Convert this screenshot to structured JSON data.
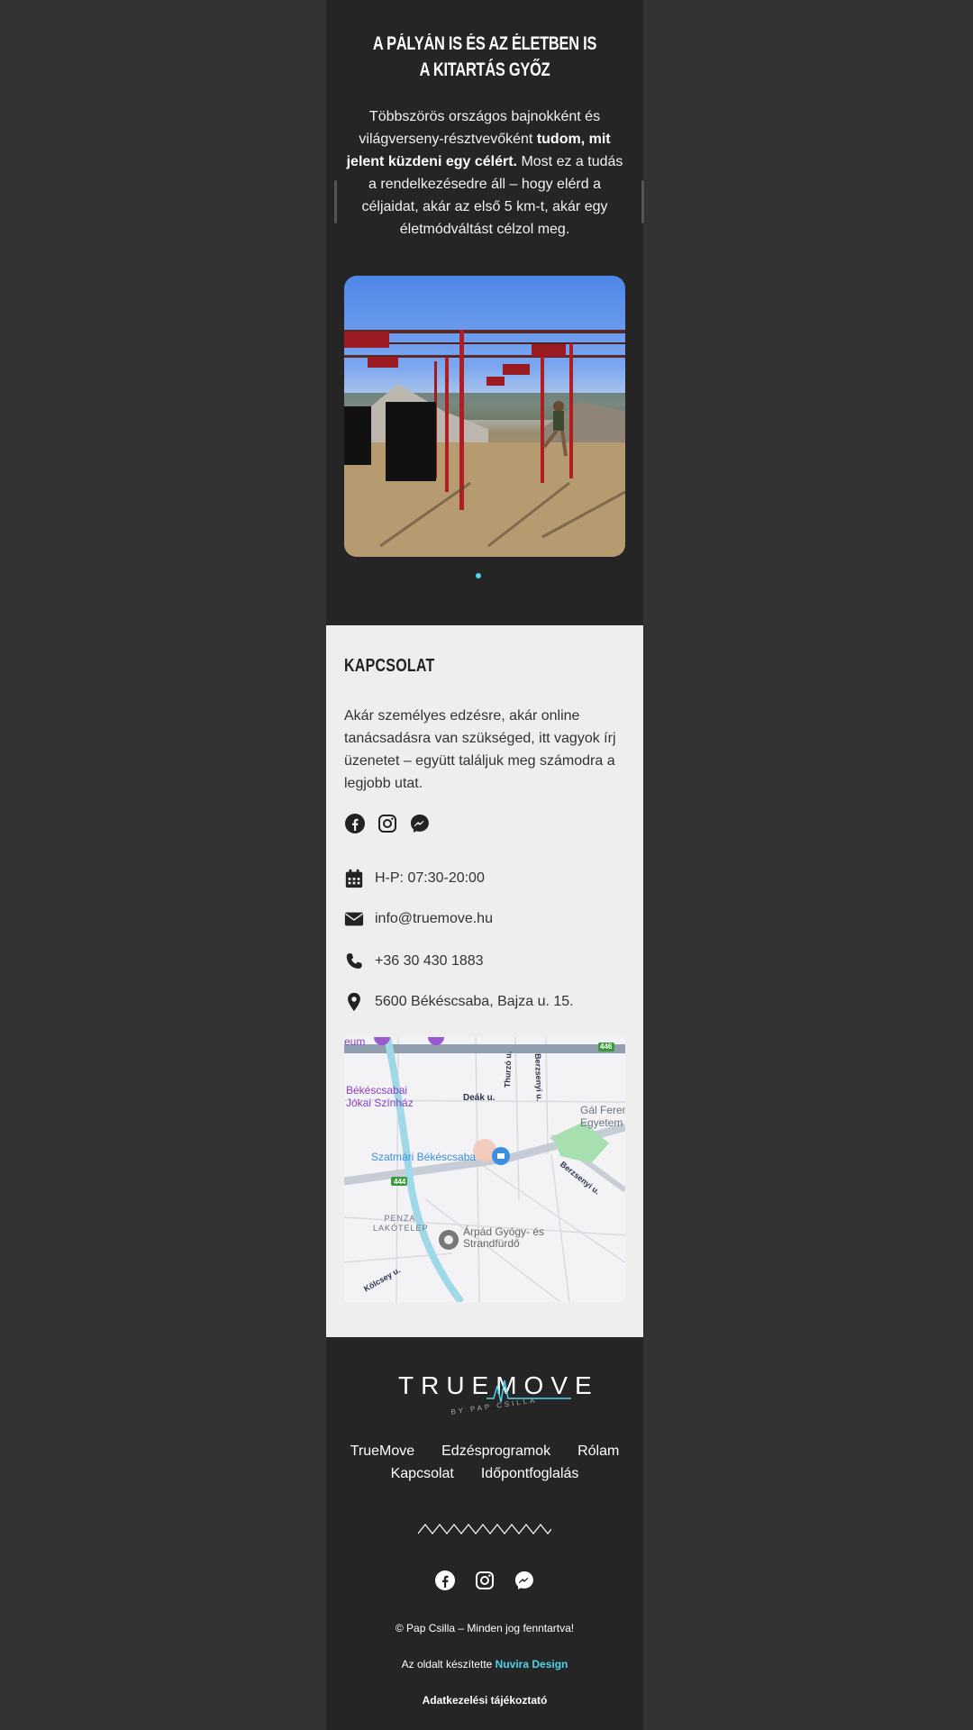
{
  "hero": {
    "title": "A PÁLYÁN IS ÉS AZ ÉLETBEN IS A KITARTÁS GYŐZ",
    "text_pre": "Többszörös országos bajnokként és világverseny-résztvevőként ",
    "text_bold": "tudom, mit jelent küzdeni egy célért.",
    "text_post": " Most ez a tudás a rendelkezésedre áll – hogy elérd a céljaidat, akár az első 5 km-t, akár egy életmódváltást célzol meg."
  },
  "contact": {
    "title": "KAPCSOLAT",
    "text": "Akár személyes edzésre, akár online tanácsadásra van szükséged, itt vagyok írj üzenetet – együtt találjuk meg számodra a legjobb utat.",
    "hours": "H-P: 07:30-20:00",
    "email": "info@truemove.hu",
    "phone": "+36 30 430 1883",
    "address": "5600 Békéscsaba, Bajza u. 15."
  },
  "map": {
    "labels": {
      "theatre": "Békéscsabai Jókai Színház",
      "deak": "Deák u.",
      "thurzo": "Thurzó u.",
      "berzsenyi_top": "Berzsenyi u.",
      "gal": "Gál Ferenc Egyetem",
      "szatmari": "Szatmári Békéscsaba",
      "berzsenyi": "Berzsenyi u.",
      "road444": "444",
      "road446": "446",
      "penza": "PENZA LAKÓTELEP",
      "arpad": "Árpád Gyógy- és Strandfürdő",
      "kolcsey": "Kölcsey u.",
      "eum": "eum"
    }
  },
  "footer": {
    "logo": "TRUEMOVE",
    "logo_sub": "BY PAP CSILLA",
    "nav": [
      "TrueMove",
      "Edzésprogramok",
      "Rólam",
      "Kapcsolat",
      "Időpontfoglalás"
    ],
    "copyright": "© Pap Csilla – Minden jog fenntartva!",
    "made_by_prefix": "Az oldalt készítette ",
    "made_by_link": "Nuvira Design",
    "privacy": "Adatkezelési tájékoztató"
  },
  "colors": {
    "accent": "#4fd3e8",
    "dark": "#252526",
    "light": "#eeeeee"
  }
}
